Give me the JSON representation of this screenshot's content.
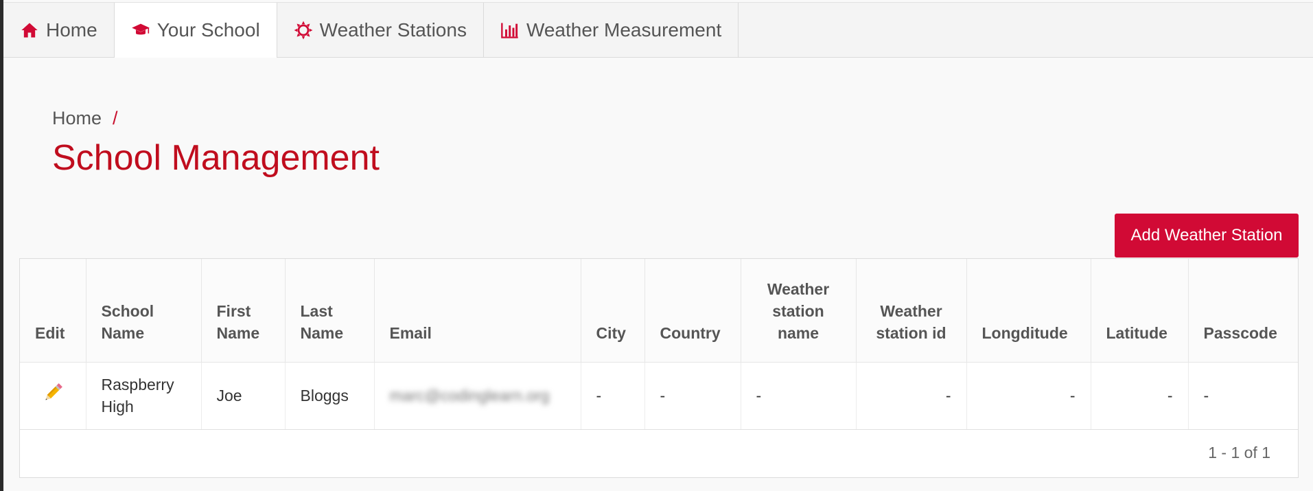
{
  "nav": {
    "tabs": [
      {
        "label": "Home",
        "icon": "home-icon"
      },
      {
        "label": "Your School",
        "icon": "graduation-cap-icon"
      },
      {
        "label": "Weather Stations",
        "icon": "sun-icon"
      },
      {
        "label": "Weather Measurement",
        "icon": "bar-chart-icon"
      }
    ],
    "accent_color": "#c8102e"
  },
  "breadcrumb": {
    "home": "Home",
    "separator": "/"
  },
  "page": {
    "title": "School Management"
  },
  "actions": {
    "add_station": "Add Weather Station"
  },
  "table": {
    "columns": [
      "Edit",
      "School Name",
      "First Name",
      "Last Name",
      "Email",
      "City",
      "Country",
      "Weather station name",
      "Weather station id",
      "Longditude",
      "Latitude",
      "Passcode"
    ],
    "rows": [
      {
        "school_name": "Raspberry High",
        "first_name": "Joe",
        "last_name": "Bloggs",
        "email": "marc@codinglearn.org",
        "city": "-",
        "country": "-",
        "station_name": "-",
        "station_id": "-",
        "longitude": "-",
        "latitude": "-",
        "passcode": "-"
      }
    ],
    "pagination": "1 - 1 of 1"
  }
}
